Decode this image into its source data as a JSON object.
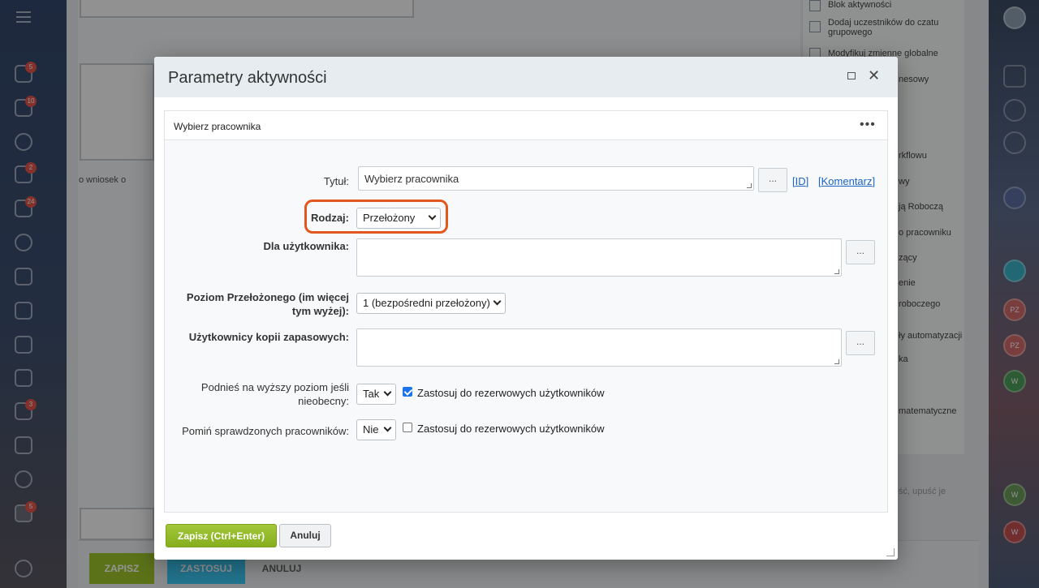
{
  "background": {
    "rail_badges": [
      "5",
      "10",
      "2",
      "24",
      "3",
      "5"
    ],
    "node_label": "o wniosek o",
    "right_panel_items": [
      "Blok aktywności",
      "Dodaj uczestników do czatu grupowego",
      "Modyfikuj zmienne globalne",
      "nesowy",
      "rkflowu",
      "wy",
      "ją Roboczą",
      "o pracowniku",
      "zący",
      "enie",
      "roboczego",
      "ły automatyzacji",
      "ka",
      "matematyczne",
      "ść, upuść je"
    ],
    "footer_buttons": {
      "save": "ZAPISZ",
      "apply": "ZASTOSUJ",
      "cancel": "ANULUJ"
    },
    "right_rail_avatars": [
      "PZ",
      "PZ",
      "W",
      "W",
      "W"
    ]
  },
  "dialog": {
    "title": "Parametry aktywności",
    "panel_title": "Wybierz pracownika",
    "fields": {
      "title_label": "Tytuł:",
      "title_value": "Wybierz pracownika",
      "dots": "...",
      "id_link": "ID",
      "comment_link": "Komentarz",
      "type_label": "Rodzaj:",
      "type_value": "Przełożony",
      "for_user_label": "Dla użytkownika:",
      "level_label_1": "Poziom Przełożonego (im więcej",
      "level_label_2": "tym wyżej):",
      "level_value": "1 (bezpośredni przełożony)",
      "backup_label": "Użytkownicy kopii zapasowych:",
      "escalate_label_1": "Podnieś na wyższy poziom jeśli",
      "escalate_label_2": "nieobecny:",
      "escalate_value": "Tak",
      "escalate_checkbox_label": "Zastosuj do rezerwowych użytkowników",
      "skip_label": "Pomiń sprawdzonych pracowników:",
      "skip_value": "Nie",
      "skip_checkbox_label": "Zastosuj do rezerwowych użytkowników"
    },
    "buttons": {
      "save": "Zapisz (Ctrl+Enter)",
      "cancel": "Anuluj"
    }
  }
}
